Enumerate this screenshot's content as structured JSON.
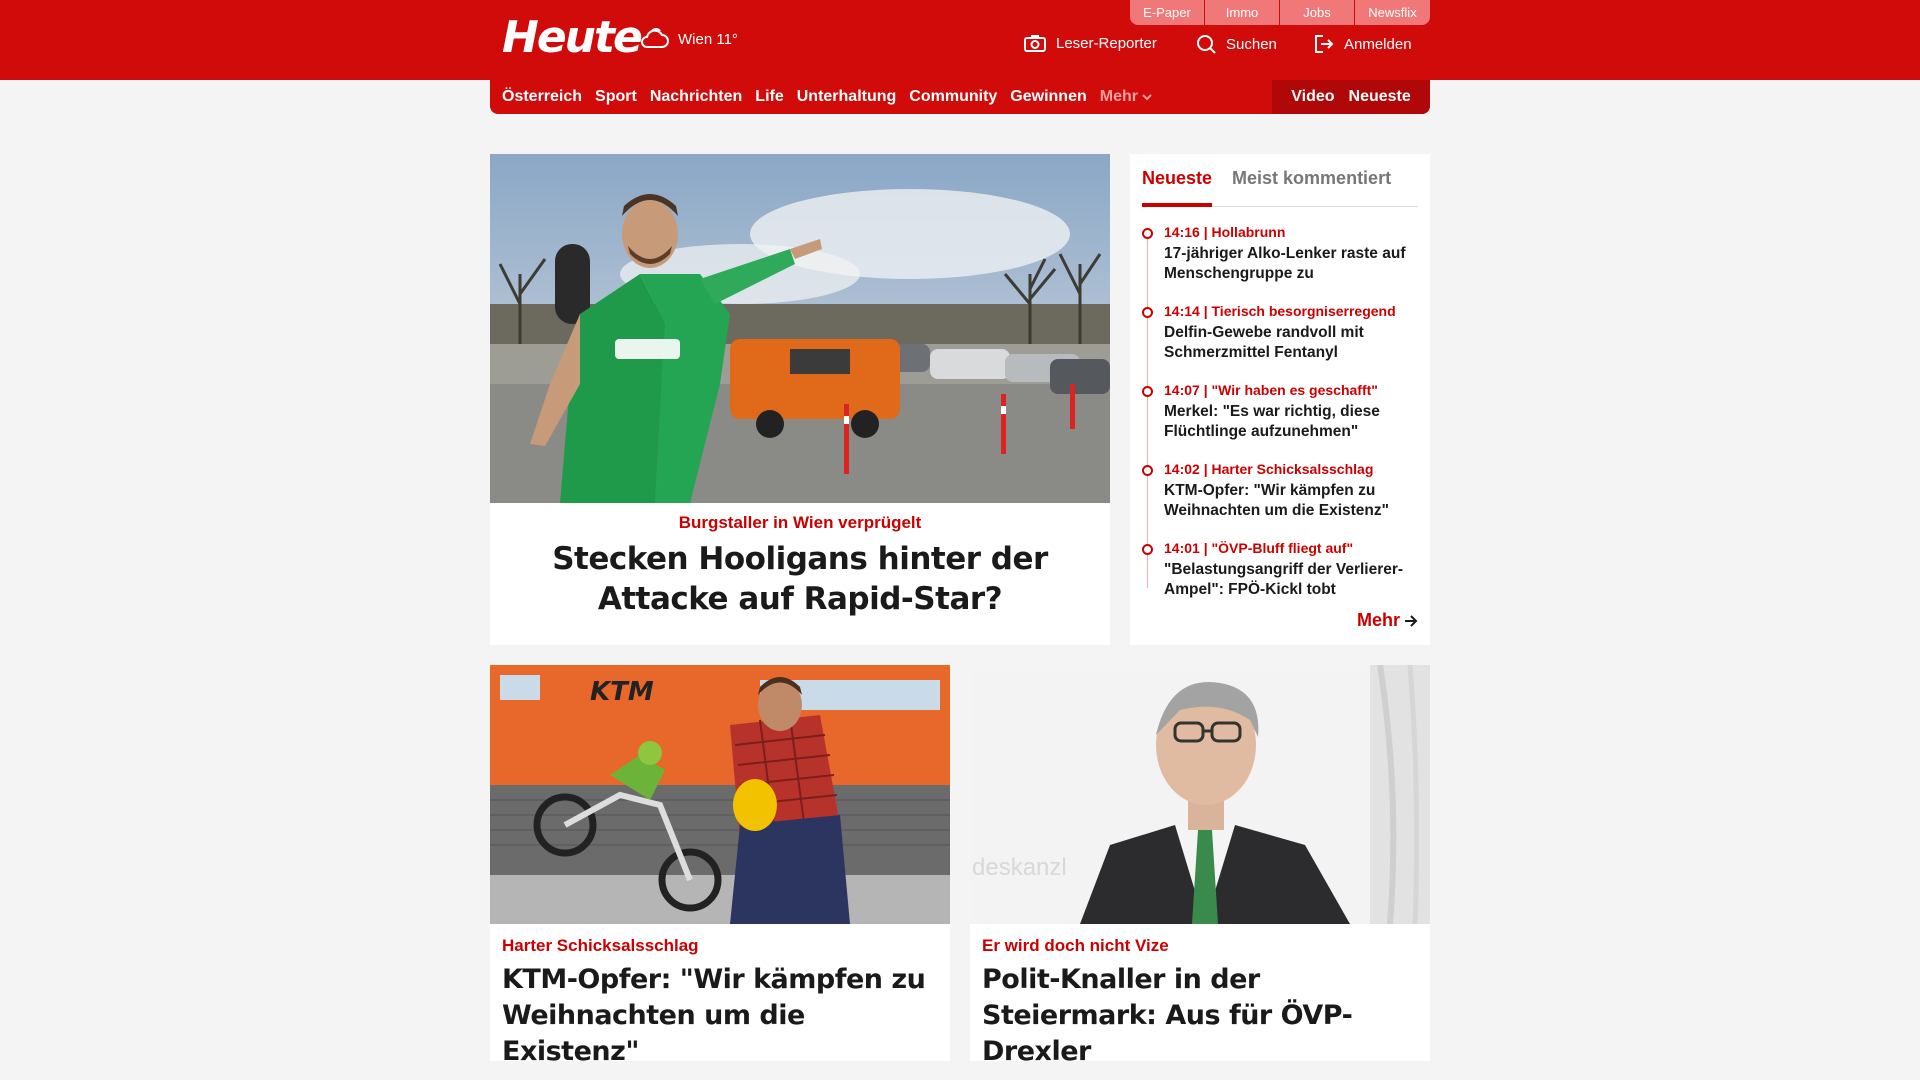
{
  "header": {
    "logo": "Heute",
    "weather": "Wien 11°",
    "quicklinks": [
      "E-Paper",
      "Immo",
      "Jobs",
      "Newsflix"
    ],
    "utilities": {
      "reporter": "Leser-Reporter",
      "search": "Suchen",
      "login": "Anmelden"
    }
  },
  "nav": {
    "items": [
      "Österreich",
      "Sport",
      "Nachrichten",
      "Life",
      "Unterhaltung",
      "Community",
      "Gewinnen"
    ],
    "more": "Mehr",
    "right": [
      "Video",
      "Neueste"
    ]
  },
  "hero": {
    "kicker": "Burgstaller in Wien verprügelt",
    "title": "Stecken Hooligans hinter der Attacke auf Rapid-Star?"
  },
  "sidebar": {
    "tabs": [
      "Neueste",
      "Meist kommentiert"
    ],
    "items": [
      {
        "meta": "14:16 | Hollabrunn",
        "title": "17-jähriger Alko-Lenker raste auf Menschengruppe zu"
      },
      {
        "meta": "14:14 | Tierisch besorgniserregend",
        "title": "Delfin-Gewebe randvoll mit Schmerzmittel Fentanyl"
      },
      {
        "meta": "14:07 | \"Wir haben es geschafft\"",
        "title": "Merkel: \"Es war richtig, diese Flüchtlinge aufzunehmen\""
      },
      {
        "meta": "14:02 | Harter Schicksalsschlag",
        "title": "KTM-Opfer: \"Wir kämpfen zu Weihnachten um die Existenz\""
      },
      {
        "meta": "14:01 | \"ÖVP-Bluff fliegt auf\"",
        "title": "\"Belastungsangriff der Verlierer-Ampel\": FPÖ-Kickl tobt"
      }
    ],
    "more": "Mehr"
  },
  "cards": [
    {
      "kicker": "Harter Schicksalsschlag",
      "title": "KTM-Opfer: \"Wir kämpfen zu Weihnachten um die Existenz\"",
      "photo_text": "KTM"
    },
    {
      "kicker": "Er wird doch nicht Vize",
      "title": "Polit-Knaller in der Steiermark: Aus für ÖVP-Drexler",
      "photo_text": "deskanzl"
    }
  ],
  "colors": {
    "brand": "#d10a0a",
    "accent": "#cc0000"
  }
}
